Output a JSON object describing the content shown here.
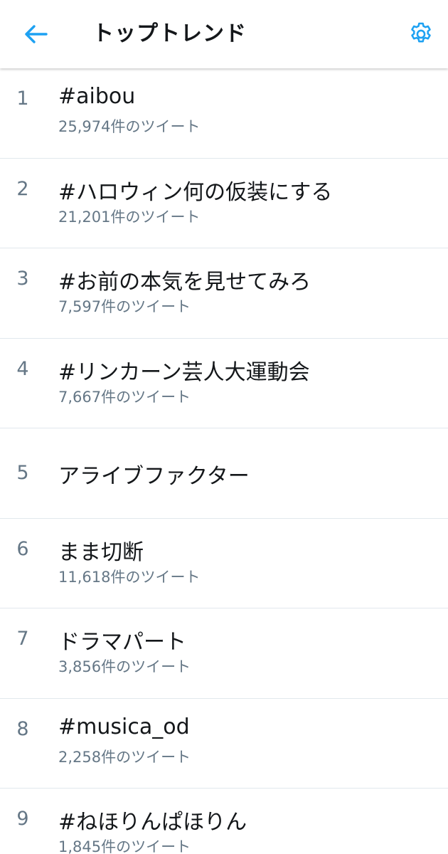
{
  "header": {
    "title": "トップトレンド",
    "back_icon": "arrow-left-icon",
    "settings_icon": "gear-icon",
    "accent_color": "#1da1f2"
  },
  "trends": [
    {
      "rank": "1",
      "name": "#aibou",
      "count": "25,974件のツイート"
    },
    {
      "rank": "2",
      "name": "#ハロウィン何の仮装にする",
      "count": "21,201件のツイート"
    },
    {
      "rank": "3",
      "name": "#お前の本気を見せてみろ",
      "count": "7,597件のツイート"
    },
    {
      "rank": "4",
      "name": "#リンカーン芸人大運動会",
      "count": "7,667件のツイート"
    },
    {
      "rank": "5",
      "name": "アライブファクター",
      "count": ""
    },
    {
      "rank": "6",
      "name": "まま切断",
      "count": "11,618件のツイート"
    },
    {
      "rank": "7",
      "name": "ドラマパート",
      "count": "3,856件のツイート"
    },
    {
      "rank": "8",
      "name": "#musica_od",
      "count": "2,258件のツイート"
    },
    {
      "rank": "9",
      "name": "#ねほりんぱほりん",
      "count": "1,845件のツイート"
    }
  ]
}
